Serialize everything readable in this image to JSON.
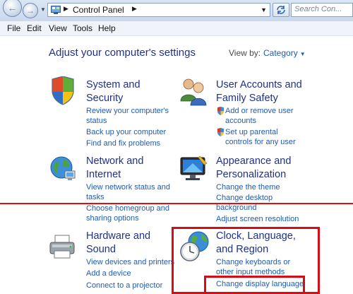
{
  "address_bar": {
    "breadcrumb": "Control Panel",
    "search_placeholder": "Search Con...",
    "icons": [
      "back-arrow-icon",
      "forward-arrow-icon",
      "control-panel-icon",
      "refresh-icon",
      "search-icon"
    ]
  },
  "menu": [
    "File",
    "Edit",
    "View",
    "Tools",
    "Help"
  ],
  "header": {
    "title": "Adjust your computer's settings",
    "view_by_label": "View by:",
    "view_by_value": "Category"
  },
  "categories": [
    {
      "title_lines": [
        "System and",
        "Security"
      ],
      "icon": "system-security-shield-icon",
      "links": [
        {
          "lines": [
            "Review your computer's",
            "status"
          ]
        },
        {
          "lines": [
            "Back up your computer"
          ]
        },
        {
          "lines": [
            "Find and fix problems"
          ]
        }
      ]
    },
    {
      "title_lines": [
        "User Accounts and",
        "Family Safety"
      ],
      "icon": "users-icon",
      "links": [
        {
          "lines": [
            "Add or remove user",
            "accounts"
          ],
          "shield": true
        },
        {
          "lines": [
            "Set up parental",
            "controls for any user"
          ],
          "shield": true
        }
      ]
    },
    {
      "title_lines": [
        "Network and",
        "Internet"
      ],
      "icon": "network-globe-icon",
      "links": [
        {
          "lines": [
            "View network status and",
            "tasks"
          ]
        },
        {
          "lines": [
            "Choose homegroup and",
            "sharing options"
          ]
        }
      ]
    },
    {
      "title_lines": [
        "Appearance and",
        "Personalization"
      ],
      "icon": "appearance-monitor-icon",
      "links": [
        {
          "lines": [
            "Change the theme"
          ]
        },
        {
          "lines": [
            "Change desktop",
            "background"
          ]
        },
        {
          "lines": [
            "Adjust screen resolution"
          ]
        }
      ]
    },
    {
      "title_lines": [
        "Hardware and",
        "Sound"
      ],
      "icon": "printer-icon",
      "links": [
        {
          "lines": [
            "View devices and printers"
          ]
        },
        {
          "lines": [
            "Add a device"
          ]
        },
        {
          "lines": [
            "Connect to a projector"
          ]
        }
      ]
    },
    {
      "title_lines": [
        "Clock, Language,",
        "and Region"
      ],
      "icon": "clock-globe-icon",
      "links": [
        {
          "lines": [
            "Change keyboards or",
            "other input methods"
          ]
        },
        {
          "lines": [
            "Change display language"
          ]
        }
      ]
    }
  ],
  "colors": {
    "title_blue": "#1e3287",
    "link_blue": "#1e5cb3",
    "highlight_red": "#d40d18"
  }
}
